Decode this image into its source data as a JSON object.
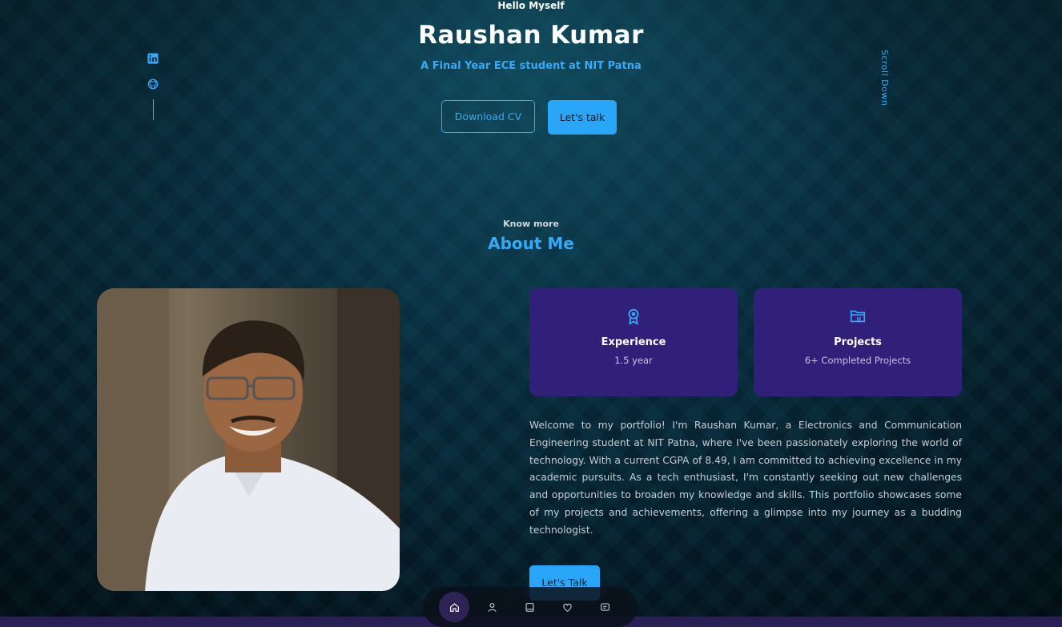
{
  "hero": {
    "greeting": "Hello Myself",
    "name": "Raushan Kumar",
    "tagline": "A Final Year ECE student at NIT Patna",
    "download_cv": "Download CV",
    "lets_talk": "Let's talk",
    "scroll_down": "Scroll Down"
  },
  "social": {
    "icons": [
      "linkedin-icon",
      "github-icon"
    ]
  },
  "about": {
    "kicker": "Know more",
    "title": "About Me",
    "cards": [
      {
        "icon": "award-icon",
        "title": "Experience",
        "subtitle": "1.5 year"
      },
      {
        "icon": "folder-icon",
        "title": "Projects",
        "subtitle": "6+ Completed Projects"
      }
    ],
    "paragraph": "Welcome to my portfolio! I'm Raushan Kumar, a Electronics and Communication Engineering student at NIT Patna, where I've been passionately exploring the world of technology. With a current CGPA of 8.49, I am committed to achieving excellence in my academic pursuits. As a tech enthusiast, I'm constantly seeking out new challenges and opportunities to broaden my knowledge and skills. This portfolio showcases some of my projects and achievements, offering a glimpse into my journey as a budding technologist.",
    "cta": "Let's Talk"
  },
  "nav": {
    "items": [
      "home-icon",
      "user-icon",
      "book-icon",
      "heart-icon",
      "message-icon"
    ],
    "active": "home-icon"
  },
  "colors": {
    "accent": "#37a9f7",
    "card": "#30207a",
    "nav_active": "#2e2256"
  }
}
